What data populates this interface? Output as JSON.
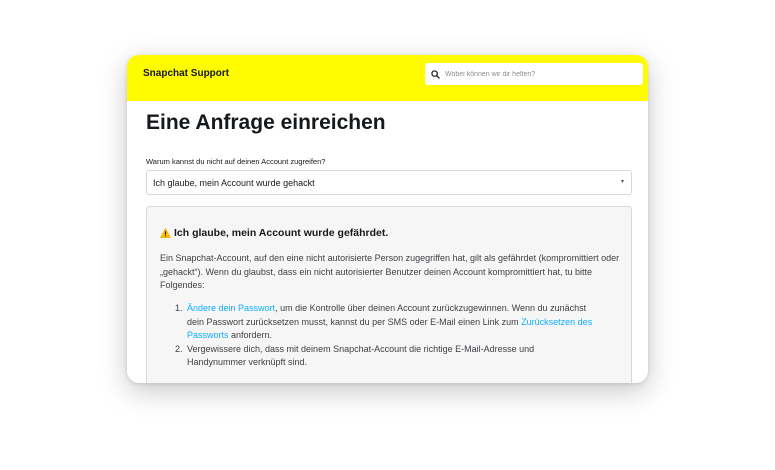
{
  "header": {
    "brand": "Snapchat Support",
    "search_placeholder": "Wobei können wir dir helfen?",
    "search_icon": "search-icon",
    "background_color": "#fffc00"
  },
  "main": {
    "title": "Eine Anfrage einreichen",
    "question_label": "Warum kannst du nicht auf deinen Account zugreifen?",
    "select": {
      "selected": "Ich glaube, mein Account wurde gehackt",
      "arrow": "▾"
    }
  },
  "info_box": {
    "heading_icon": "warning-icon",
    "heading": "Ich glaube, mein Account wurde gefährdet.",
    "body": "Ein Snapchat-Account, auf den eine nicht autorisierte Person zugegriffen hat, gilt als gefährdet (kompromittiert oder „gehackt“). Wenn du glaubst, dass ein nicht autorisierter Benutzer deinen Account kompromittiert hat, tu bitte Folgendes:",
    "steps": [
      {
        "number": "1.",
        "link1": "Ändere dein Passwort",
        "text1": ", um die Kontrolle über deinen Account zurückzugewinnen. Wenn du zunächst dein Passwort zurücksetzen musst, kannst du per SMS oder E-Mail einen Link zum ",
        "link2": "Zurücksetzen des Passworts",
        "text2": " anfordern."
      },
      {
        "number": "2.",
        "text": "Vergewissere dich, dass mit deinem Snapchat-Account die richtige E-Mail-Adresse und Handynummer verknüpft sind."
      }
    ],
    "link_color": "#0fadff"
  }
}
